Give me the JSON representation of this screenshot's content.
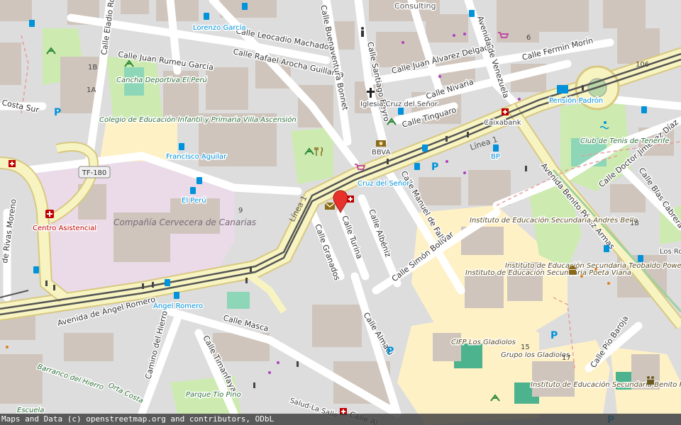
{
  "map": {
    "streets": [
      "Calle Eladio Roca",
      "Calle Juan Rumeu García",
      "Calle Leocadio Machado",
      "Calle Rafael Arocha Guillama",
      "Calle Buenaventura Bonnet",
      "Calle Santiago Beyro",
      "Calle Juan Álvarez Delgado",
      "Avenida de Venezuela",
      "Calle Fermín Morín",
      "Calle Nivaria",
      "Calle Tinguaro",
      "Calle Manuel de Falla",
      "Calle Albéniz",
      "Calle Turina",
      "Calle Granados",
      "Calle Simón Bolívar",
      "Avenida Benito Pérez Armas",
      "Calle Doctor Jiménez Díaz",
      "Calle Blas Cabrera",
      "Avenida de Ángel Romero",
      "Calle Masca",
      "Camino del Hierro",
      "Calle Timanfaya",
      "Calle Almadi",
      "Calle Pío Baroja",
      "Costa Sur",
      "de Rivas Moreno",
      "Barranco del Hierro",
      "Orta Costa",
      "Calle Al"
    ],
    "places": {
      "consulting": "Consulting",
      "lorenzo_garcia": "Lorenzo García",
      "cancha": "Cancha Deportiva El Perú",
      "colegio": "Colegio de Educación Infantil y Primaria Villa Ascensión",
      "francisco_aguilar": "Francisco Aguilar",
      "el_peru": "El Perú",
      "iglesia": "Iglesia Cruz del Señor",
      "bbva": "BBVA",
      "cruz_del_senor": "Cruz del Señor",
      "caixabank": "Caixabank",
      "pension_padron": "Pensión Padrón",
      "linea1_a": "Línea 1",
      "linea1_b": "Línea 1",
      "bp": "BP",
      "club_tenis": "Club de Tenis de Tenerife",
      "tf180": "TF-180",
      "centro_asistencial": "Centro Asistencial",
      "compania": "Compañía Cervecera de Canarias",
      "angel_romero": "Ángel Romero",
      "ies_andres_bello": "Instituto de Educación Secundaria Andrés Bello",
      "ies_poeta_viana": "Instituto de Educación Secundaria Poeta Viana",
      "ies_teobaldo_power": "Instituto de Educación Secundaria Teobaldo Power",
      "cifp": "CIFP Los Gladiolos",
      "grupo_gladiolos": "Grupo los Gladiolos",
      "ies_benito": "Instituto de Educación Secundaria Benito Pérez Armas",
      "parque_tio_pino": "Parque Tío Pino",
      "escuela": "Escuela",
      "salud": "Salud-La Salle",
      "los_ros": "Los Ros"
    },
    "house_numbers": [
      "6",
      "106",
      "18",
      "15",
      "17",
      "1B",
      "1A",
      "9"
    ],
    "colors": {
      "background": "#dddddd",
      "building": "#cfc5bc",
      "major_road": "#f7f4c2",
      "tram": "#555555",
      "park": "#cdebb0",
      "school": "#fff1c6",
      "industrial": "#ebdbe8",
      "marker": "#e8312a",
      "bus_stop": "#0092da"
    }
  },
  "attribution": "Maps and Data (c) openstreetmap.org and contributors, ODbL"
}
